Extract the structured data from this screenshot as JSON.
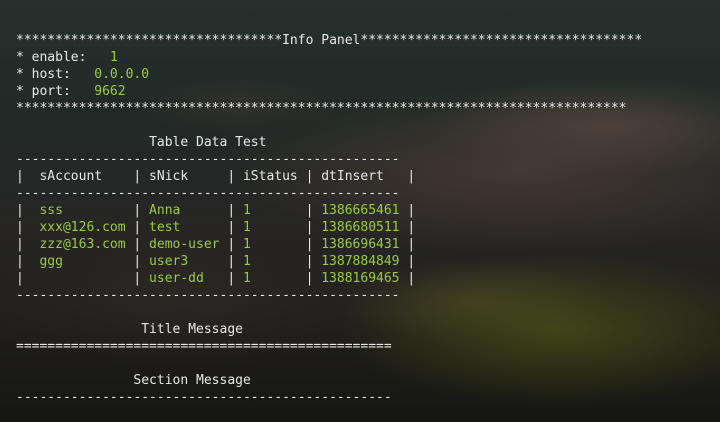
{
  "info_panel": {
    "title": "Info Panel",
    "enable_label": "enable:",
    "enable_value": "1",
    "host_label": "host:",
    "host_value": "0.0.0.0",
    "port_label": "port:",
    "port_value": "9662"
  },
  "table": {
    "title": "Table Data Test",
    "columns": [
      "sAccount",
      "sNick",
      "iStatus",
      "dtInsert"
    ],
    "rows": [
      [
        "sss",
        "Anna",
        "1",
        "1386665461"
      ],
      [
        "xxx@126.com",
        "test",
        "1",
        "1386680511"
      ],
      [
        "zzz@163.com",
        "demo-user",
        "1",
        "1386696431"
      ],
      [
        "ggg",
        "user3",
        "1",
        "1387884849"
      ],
      [
        "",
        "user-dd",
        "1",
        "1388169465"
      ]
    ]
  },
  "title_message": "Title Message",
  "section_message": "Section Message",
  "colors": {
    "text": "#e8e8e8",
    "value": "#9ccc3c"
  }
}
